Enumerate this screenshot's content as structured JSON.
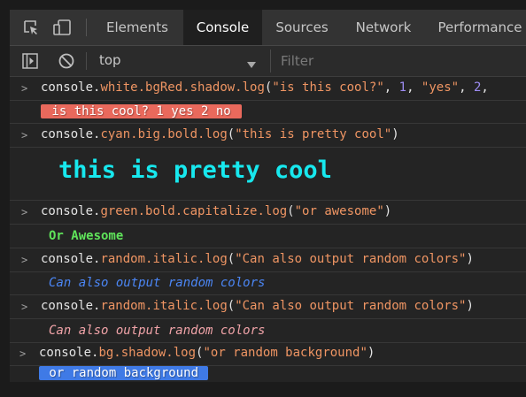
{
  "tabs": {
    "elements": "Elements",
    "console": "Console",
    "sources": "Sources",
    "network": "Network",
    "performance": "Performance"
  },
  "toolbar": {
    "context": "top",
    "filter_placeholder": "Filter"
  },
  "entries": [
    {
      "code": {
        "obj": "console",
        "chain": "white.bgRed.shadow.log",
        "args_open": "(",
        "s1": "\"is this cool?\"",
        "n1": "1",
        "s2": "\"yes\"",
        "n2": "2"
      },
      "output": " is this cool? 1 yes 2 no "
    },
    {
      "code": {
        "obj": "console",
        "chain": "cyan.big.bold.log",
        "s1": "\"this is pretty cool\""
      },
      "output": "this is pretty cool"
    },
    {
      "code": {
        "obj": "console",
        "chain": "green.bold.capitalize.log",
        "s1": "\"or awesome\""
      },
      "output": "Or Awesome"
    },
    {
      "code": {
        "obj": "console",
        "chain": "random.italic.log",
        "s1": "\"Can also output random colors\""
      },
      "output": "Can also output random colors"
    },
    {
      "code": {
        "obj": "console",
        "chain": "random.italic.log",
        "s1": "\"Can also output random colors\""
      },
      "output": "Can also output random colors"
    },
    {
      "code": {
        "obj": "console",
        "chain": "bg.shadow.log",
        "s1": "\"or random background\""
      },
      "output": " or random background "
    }
  ],
  "colors": {
    "bg_red": "#e9695c",
    "cyan": "#17e8ee",
    "green": "#5fe35a",
    "blue_text": "#4b86f5",
    "pink_text": "#f0a3a8",
    "bg_blue": "#3f7ae6"
  }
}
